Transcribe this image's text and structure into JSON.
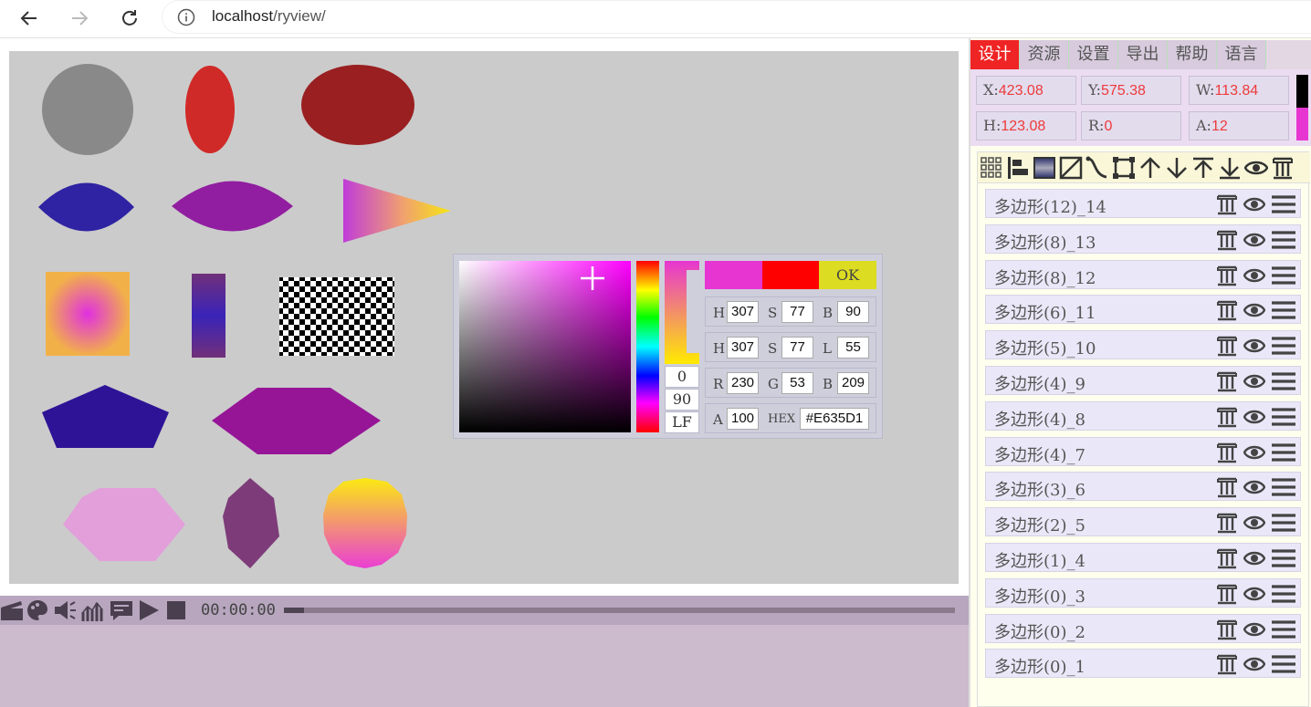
{
  "browser": {
    "url_host": "localhost",
    "url_path": "/ryview/"
  },
  "colors": {
    "accent_tab": "#ef2424",
    "selected_fill": "#e635d1",
    "value_red": "#ee3a3a"
  },
  "picker": {
    "ok_label": "OK",
    "swatch_current": "#e635d1",
    "swatch_previous": "#ff0000",
    "gradient_values": [
      "0",
      "90",
      "LF"
    ],
    "hsb": [
      {
        "label": "H",
        "value": "307"
      },
      {
        "label": "S",
        "value": "77"
      },
      {
        "label": "B",
        "value": "90"
      }
    ],
    "hsl": [
      {
        "label": "H",
        "value": "307"
      },
      {
        "label": "S",
        "value": "77"
      },
      {
        "label": "L",
        "value": "55"
      }
    ],
    "rgb": [
      {
        "label": "R",
        "value": "230"
      },
      {
        "label": "G",
        "value": "53"
      },
      {
        "label": "B",
        "value": "209"
      }
    ],
    "alpha_label": "A",
    "alpha_value": "100",
    "hex_label": "HEX",
    "hex_value": "#E635D1"
  },
  "timeline": {
    "timecode": "00:00:00",
    "progress": 0.03
  },
  "panel": {
    "tabs": [
      "设计",
      "资源",
      "设置",
      "导出",
      "帮助",
      "语言"
    ],
    "active_tab": 0,
    "props": [
      {
        "label": "X:",
        "value": "423.08"
      },
      {
        "label": "Y:",
        "value": "575.38"
      },
      {
        "label": "W:",
        "value": "113.84"
      },
      {
        "label": "H:",
        "value": "123.08"
      },
      {
        "label": "R:",
        "value": "0"
      },
      {
        "label": "A:",
        "value": "12"
      }
    ],
    "toolbar_icons": [
      "grid-icon",
      "align-icon",
      "fill-gradient-icon",
      "no-fill-icon",
      "curve-icon",
      "transform-icon",
      "move-up-icon",
      "move-down-icon",
      "move-top-icon",
      "move-bottom-icon",
      "eye-icon",
      "delete-icon"
    ],
    "layers": [
      "多边形(12)_14",
      "多边形(8)_13",
      "多边形(8)_12",
      "多边形(6)_11",
      "多边形(5)_10",
      "多边形(4)_9",
      "多边形(4)_8",
      "多边形(4)_7",
      "多边形(3)_6",
      "多边形(2)_5",
      "多边形(1)_4",
      "多边形(0)_3",
      "多边形(0)_2",
      "多边形(0)_1"
    ]
  }
}
